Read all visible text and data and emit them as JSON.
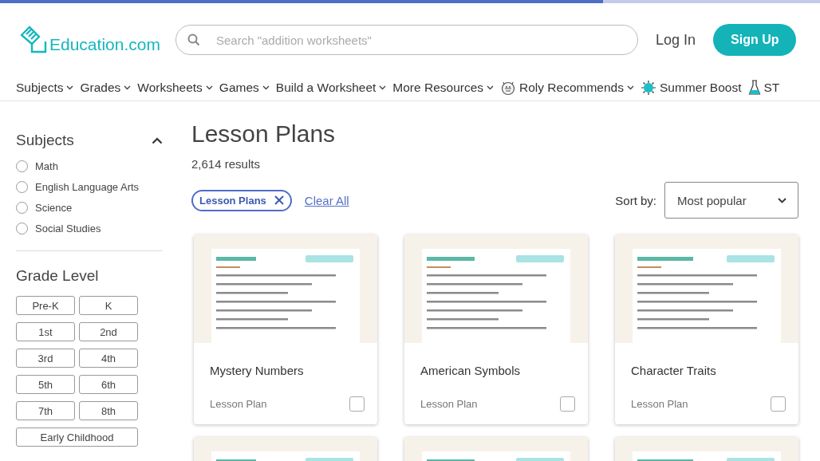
{
  "progress": {
    "level": 0.735
  },
  "header": {
    "logo": "Education.com",
    "search": {
      "placeholder": "Search \"addition worksheets\""
    },
    "login": "Log In",
    "signup": "Sign Up"
  },
  "nav": [
    {
      "label": "Subjects",
      "kind": "menu"
    },
    {
      "label": "Grades",
      "kind": "menu"
    },
    {
      "label": "Worksheets",
      "kind": "menu"
    },
    {
      "label": "Games",
      "kind": "menu"
    },
    {
      "label": "Build a Worksheet",
      "kind": "menu"
    },
    {
      "label": "More Resources",
      "kind": "menu"
    },
    {
      "label": "Roly Recommends",
      "kind": "roly"
    },
    {
      "label": "Summer Boost",
      "kind": "sun"
    },
    {
      "label": "ST",
      "kind": "flask"
    }
  ],
  "sidebar": {
    "subjects": {
      "title": "Subjects",
      "expanded": true,
      "items": [
        {
          "label": "Math",
          "selected": false
        },
        {
          "label": "English Language Arts",
          "selected": false
        },
        {
          "label": "Science",
          "selected": false
        },
        {
          "label": "Social Studies",
          "selected": false
        }
      ]
    },
    "grades": {
      "title": "Grade Level",
      "items": [
        {
          "label": "Pre-K",
          "selected": false,
          "wide": false
        },
        {
          "label": "K",
          "selected": false,
          "wide": false
        },
        {
          "label": "1st",
          "selected": false,
          "wide": false
        },
        {
          "label": "2nd",
          "selected": false,
          "wide": false
        },
        {
          "label": "3rd",
          "selected": false,
          "wide": false
        },
        {
          "label": "4th",
          "selected": false,
          "wide": false
        },
        {
          "label": "5th",
          "selected": false,
          "wide": false
        },
        {
          "label": "6th",
          "selected": false,
          "wide": false
        },
        {
          "label": "7th",
          "selected": false,
          "wide": false
        },
        {
          "label": "8th",
          "selected": false,
          "wide": false
        },
        {
          "label": "Early Childhood",
          "selected": false,
          "wide": true
        }
      ]
    }
  },
  "main": {
    "title": "Lesson Plans",
    "count": "2,614 results",
    "filters": [
      {
        "label": "Lesson Plans"
      }
    ],
    "clear": "Clear All",
    "sort_label": "Sort by:",
    "sort_value": "Most popular",
    "cards": [
      {
        "kind": "lesson",
        "title": "Mystery Numbers",
        "type": "Lesson Plan",
        "checked": false
      },
      {
        "kind": "lesson",
        "title": "American Symbols",
        "type": "Lesson Plan",
        "checked": false
      },
      {
        "kind": "lesson",
        "title": "Character Traits",
        "type": "Lesson Plan",
        "checked": false
      },
      {
        "kind": "picture"
      },
      {
        "kind": "picture"
      },
      {
        "kind": "picture"
      }
    ]
  }
}
